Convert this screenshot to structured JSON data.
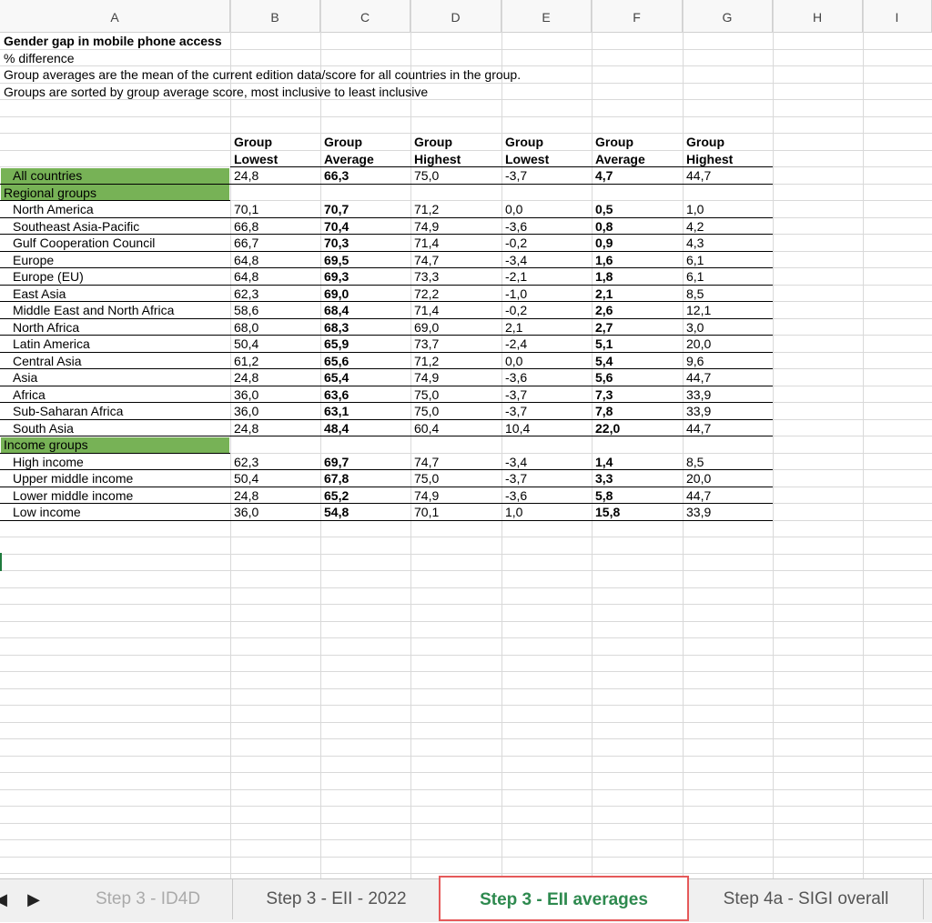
{
  "columns": [
    "A",
    "B",
    "C",
    "D",
    "E",
    "F",
    "G",
    "H",
    "I"
  ],
  "title": "Gender gap in mobile phone access",
  "subtitle": "% difference",
  "note1": "Group averages are the mean of the current edition data/score for all countries in the group.",
  "note2": "Groups are sorted by group average score, most inclusive to least inclusive",
  "header_top": [
    "Group",
    "Group",
    "Group",
    "Group",
    "Group",
    "Group"
  ],
  "header_bottom": [
    "Lowest",
    "Average",
    "Highest",
    "Lowest",
    "Average",
    "Highest"
  ],
  "all_countries": {
    "label": "All countries",
    "values": [
      "24,8",
      "66,3",
      "75,0",
      "-3,7",
      "4,7",
      "44,7"
    ]
  },
  "regional_label": "Regional groups",
  "regional": [
    {
      "label": "North America",
      "values": [
        "70,1",
        "70,7",
        "71,2",
        "0,0",
        "0,5",
        "1,0"
      ]
    },
    {
      "label": "Southeast Asia-Pacific",
      "values": [
        "66,8",
        "70,4",
        "74,9",
        "-3,6",
        "0,8",
        "4,2"
      ]
    },
    {
      "label": "Gulf Cooperation Council",
      "values": [
        "66,7",
        "70,3",
        "71,4",
        "-0,2",
        "0,9",
        "4,3"
      ]
    },
    {
      "label": "Europe",
      "values": [
        "64,8",
        "69,5",
        "74,7",
        "-3,4",
        "1,6",
        "6,1"
      ]
    },
    {
      "label": "Europe (EU)",
      "values": [
        "64,8",
        "69,3",
        "73,3",
        "-2,1",
        "1,8",
        "6,1"
      ]
    },
    {
      "label": "East Asia",
      "values": [
        "62,3",
        "69,0",
        "72,2",
        "-1,0",
        "2,1",
        "8,5"
      ]
    },
    {
      "label": "Middle East and North Africa",
      "values": [
        "58,6",
        "68,4",
        "71,4",
        "-0,2",
        "2,6",
        "12,1"
      ]
    },
    {
      "label": "North Africa",
      "values": [
        "68,0",
        "68,3",
        "69,0",
        "2,1",
        "2,7",
        "3,0"
      ]
    },
    {
      "label": "Latin America",
      "values": [
        "50,4",
        "65,9",
        "73,7",
        "-2,4",
        "5,1",
        "20,0"
      ]
    },
    {
      "label": "Central Asia",
      "values": [
        "61,2",
        "65,6",
        "71,2",
        "0,0",
        "5,4",
        "9,6"
      ]
    },
    {
      "label": "Asia",
      "values": [
        "24,8",
        "65,4",
        "74,9",
        "-3,6",
        "5,6",
        "44,7"
      ]
    },
    {
      "label": "Africa",
      "values": [
        "36,0",
        "63,6",
        "75,0",
        "-3,7",
        "7,3",
        "33,9"
      ]
    },
    {
      "label": "Sub-Saharan Africa",
      "values": [
        "36,0",
        "63,1",
        "75,0",
        "-3,7",
        "7,8",
        "33,9"
      ]
    },
    {
      "label": "South Asia",
      "values": [
        "24,8",
        "48,4",
        "60,4",
        "10,4",
        "22,0",
        "44,7"
      ]
    }
  ],
  "income_label": "Income groups",
  "income": [
    {
      "label": "High income",
      "values": [
        "62,3",
        "69,7",
        "74,7",
        "-3,4",
        "1,4",
        "8,5"
      ]
    },
    {
      "label": "Upper middle income",
      "values": [
        "50,4",
        "67,8",
        "75,0",
        "-3,7",
        "3,3",
        "20,0"
      ]
    },
    {
      "label": "Lower middle income",
      "values": [
        "24,8",
        "65,2",
        "74,9",
        "-3,6",
        "5,8",
        "44,7"
      ]
    },
    {
      "label": "Low income",
      "values": [
        "36,0",
        "54,8",
        "70,1",
        "1,0",
        "15,8",
        "33,9"
      ]
    }
  ],
  "tabs": [
    {
      "label": "Step 3 - ID4D",
      "active": false
    },
    {
      "label": "Step 3 - EII - 2022",
      "active": false
    },
    {
      "label": "Step 3 - EII averages",
      "active": true
    },
    {
      "label": "Step 4a - SIGI overall",
      "active": false
    }
  ],
  "colors": {
    "group_fill": "#77b256",
    "active_tab_text": "#2e8a4f",
    "active_tab_border": "#e5595a"
  }
}
